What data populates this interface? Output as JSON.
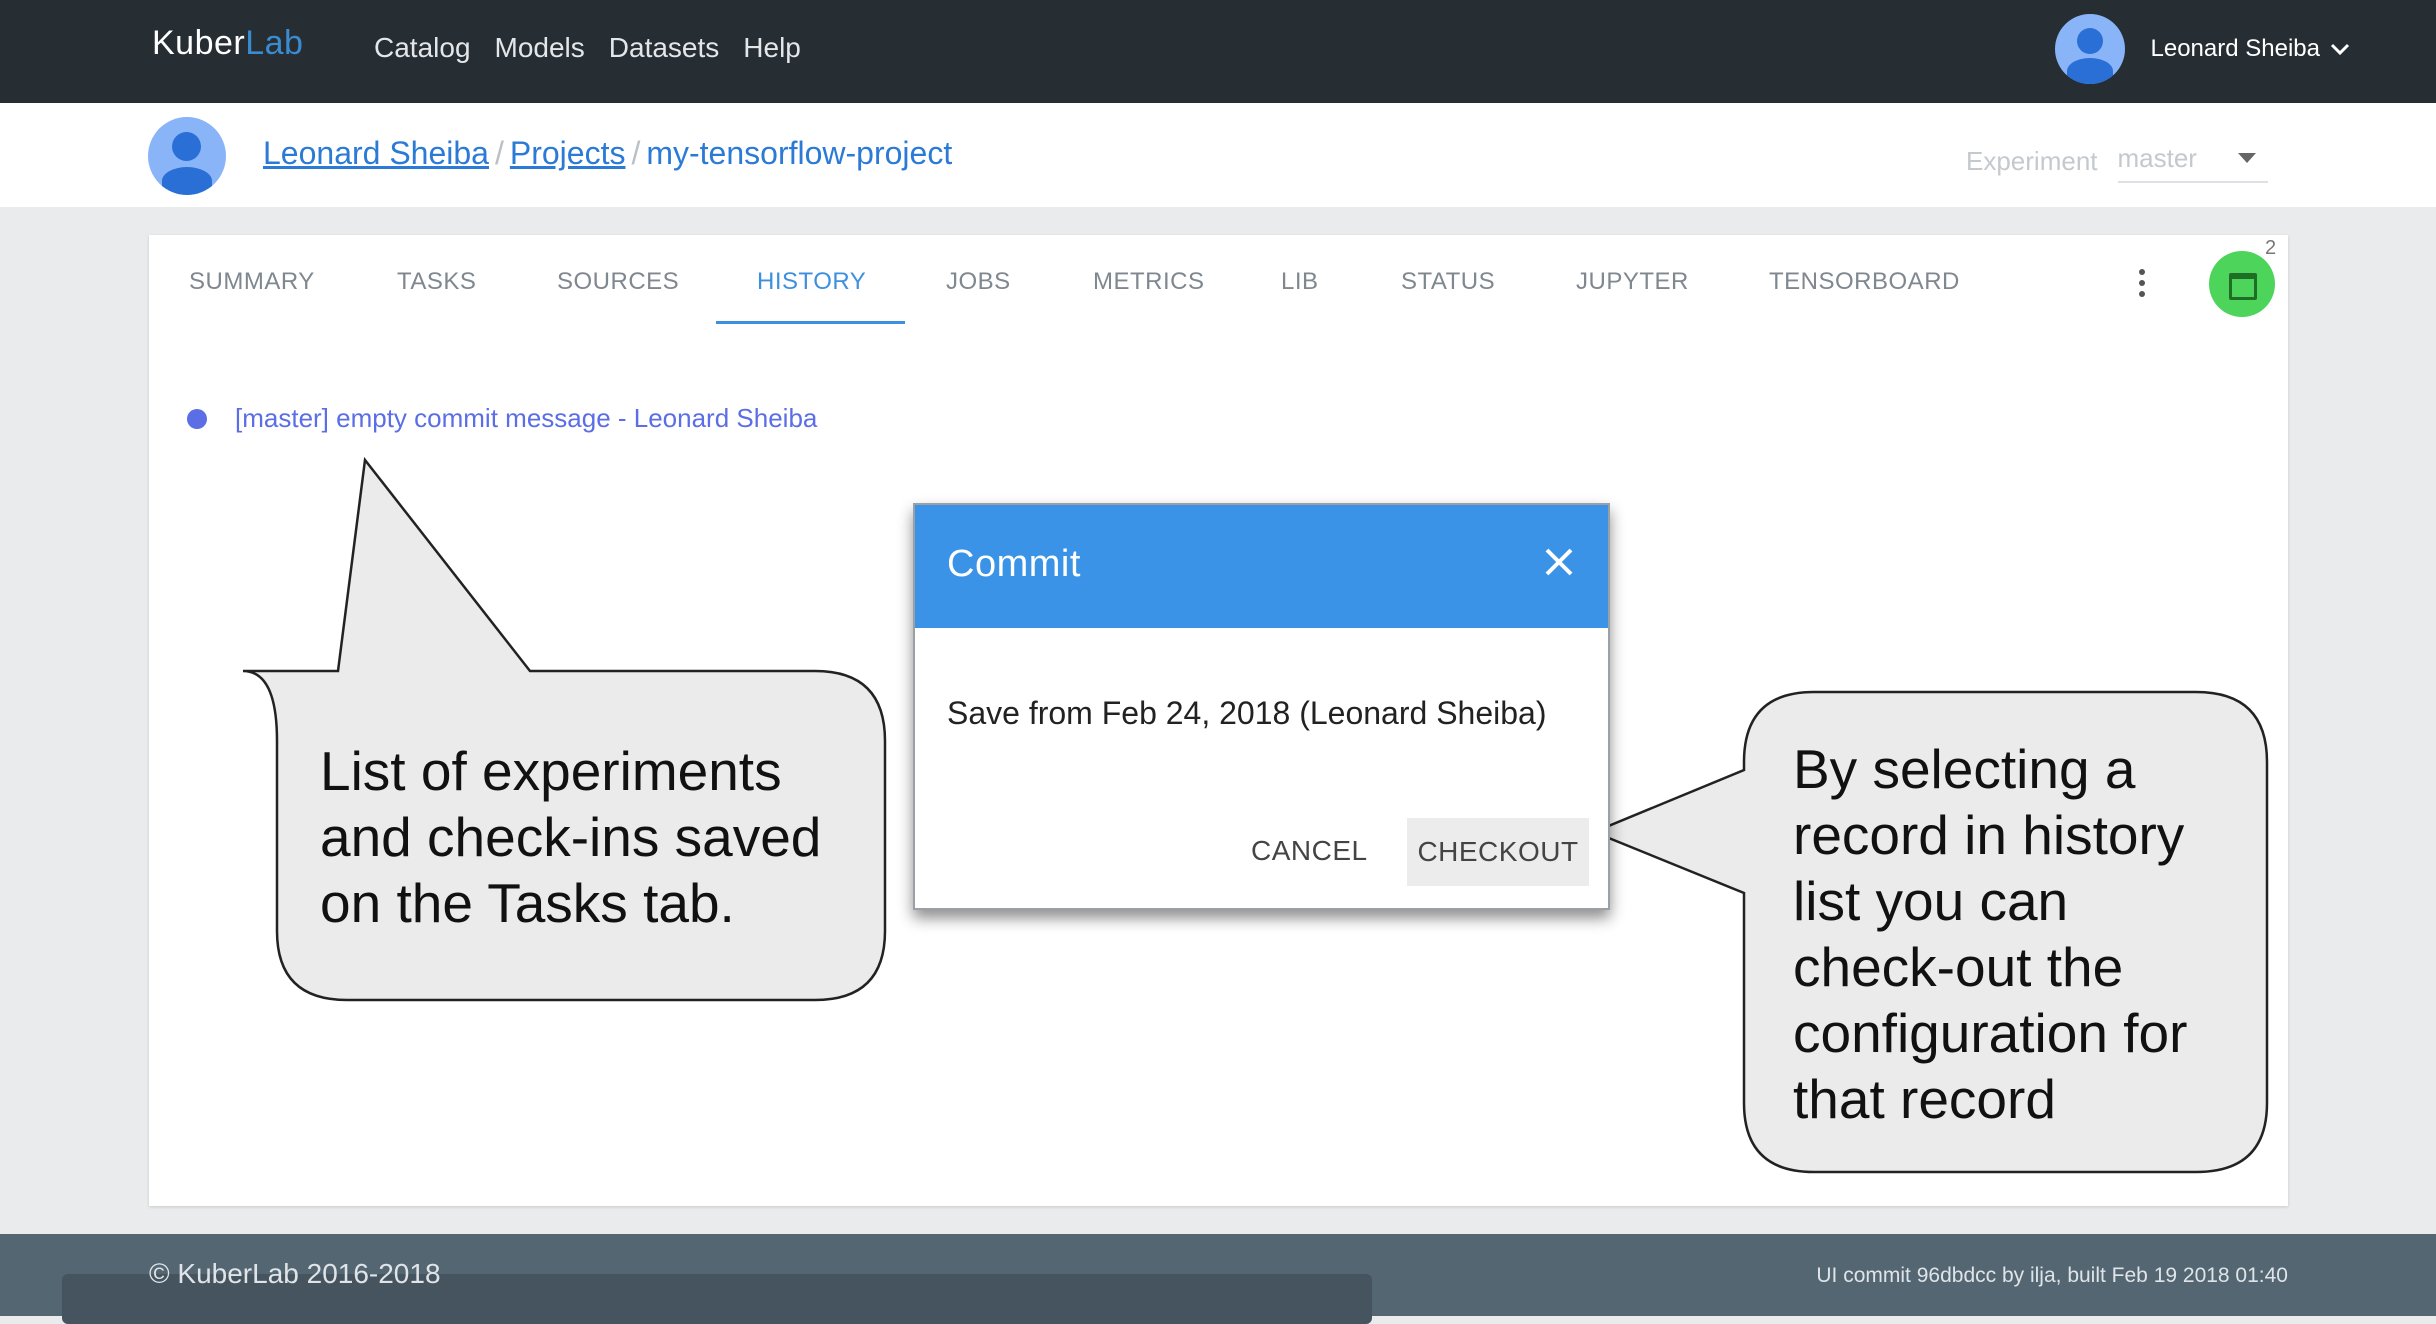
{
  "topnav": {
    "logo_a": "Kuber",
    "logo_b": "Lab",
    "links": [
      "Catalog",
      "Models",
      "Datasets",
      "Help"
    ],
    "user_name": "Leonard Sheiba",
    "chevron": "⌄"
  },
  "breadcrumb": {
    "user": "Leonard Sheiba",
    "sep": "/",
    "projects": "Projects",
    "project": "my-tensorflow-project"
  },
  "experiment": {
    "label": "Experiment",
    "value": "master"
  },
  "tabs": [
    "SUMMARY",
    "TASKS",
    "SOURCES",
    "HISTORY",
    "JOBS",
    "METRICS",
    "LIB",
    "STATUS",
    "JUPYTER",
    "TENSORBOARD"
  ],
  "active_tab": "HISTORY",
  "fab_badge": "2",
  "history": [
    {
      "text": "[master] empty commit message - Leonard Sheiba"
    }
  ],
  "callouts": {
    "left": [
      "List of experiments",
      "and check-ins saved",
      "on the Tasks tab."
    ],
    "right": [
      "By selecting a",
      "record in history",
      "list you can",
      "check-out the",
      "configuration for",
      "that record"
    ]
  },
  "modal": {
    "title": "Commit",
    "body": "Save from Feb 24, 2018 (Leonard Sheiba)",
    "cancel": "CANCEL",
    "checkout": "CHECKOUT"
  },
  "footer": {
    "copyright": "© KuberLab 2016-2018",
    "build": "UI commit 96dbdcc by ilja, built Feb 19 2018 01:40"
  },
  "colors": {
    "nav_bg": "#262d33",
    "accent": "#3a93e6",
    "link": "#2b7bd6",
    "history_text": "#5b6ee6",
    "fab": "#4cd55a"
  }
}
